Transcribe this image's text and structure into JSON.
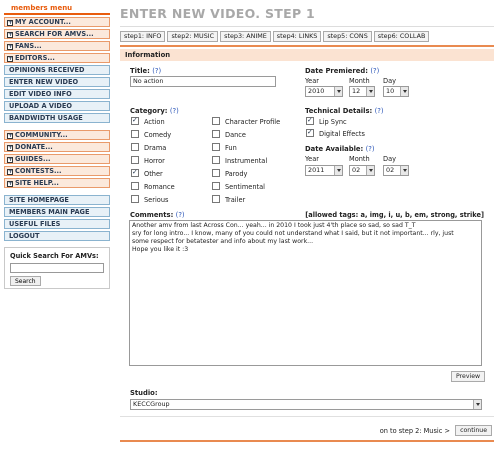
{
  "sidebar": {
    "heading": "members menu",
    "group1": [
      {
        "label": "MY ACCOUNT...",
        "expandable": true
      },
      {
        "label": "SEARCH FOR AMVS...",
        "expandable": true
      },
      {
        "label": "FANS...",
        "expandable": true
      },
      {
        "label": "EDITORS...",
        "expandable": true
      }
    ],
    "group2": [
      {
        "label": "OPINIONS RECEIVED"
      },
      {
        "label": "ENTER NEW VIDEO"
      },
      {
        "label": "EDIT VIDEO INFO"
      },
      {
        "label": "UPLOAD A VIDEO"
      },
      {
        "label": "BANDWIDTH USAGE"
      }
    ],
    "group3": [
      {
        "label": "COMMUNITY...",
        "expandable": true
      },
      {
        "label": "DONATE...",
        "expandable": true
      },
      {
        "label": "GUIDES...",
        "expandable": true
      },
      {
        "label": "CONTESTS...",
        "expandable": true
      },
      {
        "label": "SITE HELP...",
        "expandable": true
      }
    ],
    "group4": [
      {
        "label": "SITE HOMEPAGE"
      },
      {
        "label": "MEMBERS MAIN PAGE"
      },
      {
        "label": "USEFUL FILES"
      },
      {
        "label": "LOGOUT"
      }
    ],
    "quick_search": {
      "title": "Quick Search For AMVs:",
      "value": "",
      "button": "Search"
    },
    "plus_glyph": "+"
  },
  "main": {
    "title": "ENTER NEW VIDEO. STEP 1",
    "tabs": [
      "step1: INFO",
      "step2: MUSIC",
      "step3: ANIME",
      "step4: LINKS",
      "step5: CONS",
      "step6: COLLAB"
    ],
    "section": "Information",
    "help_text": "(?)",
    "title_label": "Title:",
    "title_value": "No action",
    "date_premiered": {
      "label": "Date Premiered:",
      "year_label": "Year",
      "month_label": "Month",
      "day_label": "Day",
      "year": "2010",
      "month": "12",
      "day": "10"
    },
    "category": {
      "label": "Category:",
      "col1": [
        {
          "label": "Action",
          "checked": true
        },
        {
          "label": "Comedy",
          "checked": false
        },
        {
          "label": "Drama",
          "checked": false
        },
        {
          "label": "Horror",
          "checked": false
        },
        {
          "label": "Other",
          "checked": true
        },
        {
          "label": "Romance",
          "checked": false
        },
        {
          "label": "Serious",
          "checked": false
        }
      ],
      "col2": [
        {
          "label": "Character Profile",
          "checked": false
        },
        {
          "label": "Dance",
          "checked": false
        },
        {
          "label": "Fun",
          "checked": false
        },
        {
          "label": "Instrumental",
          "checked": false
        },
        {
          "label": "Parody",
          "checked": false
        },
        {
          "label": "Sentimental",
          "checked": false
        },
        {
          "label": "Trailer",
          "checked": false
        }
      ]
    },
    "technical": {
      "label": "Technical Details:",
      "items": [
        {
          "label": "Lip Sync",
          "checked": true
        },
        {
          "label": "Digital Effects",
          "checked": true
        }
      ]
    },
    "date_available": {
      "label": "Date Available:",
      "year_label": "Year",
      "month_label": "Month",
      "day_label": "Day",
      "year": "2011",
      "month": "02",
      "day": "02"
    },
    "comments": {
      "label": "Comments:",
      "allowed_tags": "[allowed tags: a, img, i, u, b, em, strong, strike]",
      "lines": [
        "Another amv from last Across Con... yeah... in 2010 I took just 4'th place so sad, so sad T_T",
        "sry for long intro... I know, many of you could not understand what I said, but it not important... rly, just",
        "some respect for betatester and info about my last work...",
        "Hope you like it :3"
      ],
      "preview_button": "Preview"
    },
    "studio": {
      "label": "Studio:",
      "value": "KECCGroup"
    },
    "next": {
      "text": "on to step 2: Music >",
      "button": "continue"
    }
  },
  "colors": {
    "accent": "#e98a50",
    "heading_orange": "#e85c0d",
    "menu_blue_border": "#8ab3cf",
    "link": "#2a55b8"
  }
}
